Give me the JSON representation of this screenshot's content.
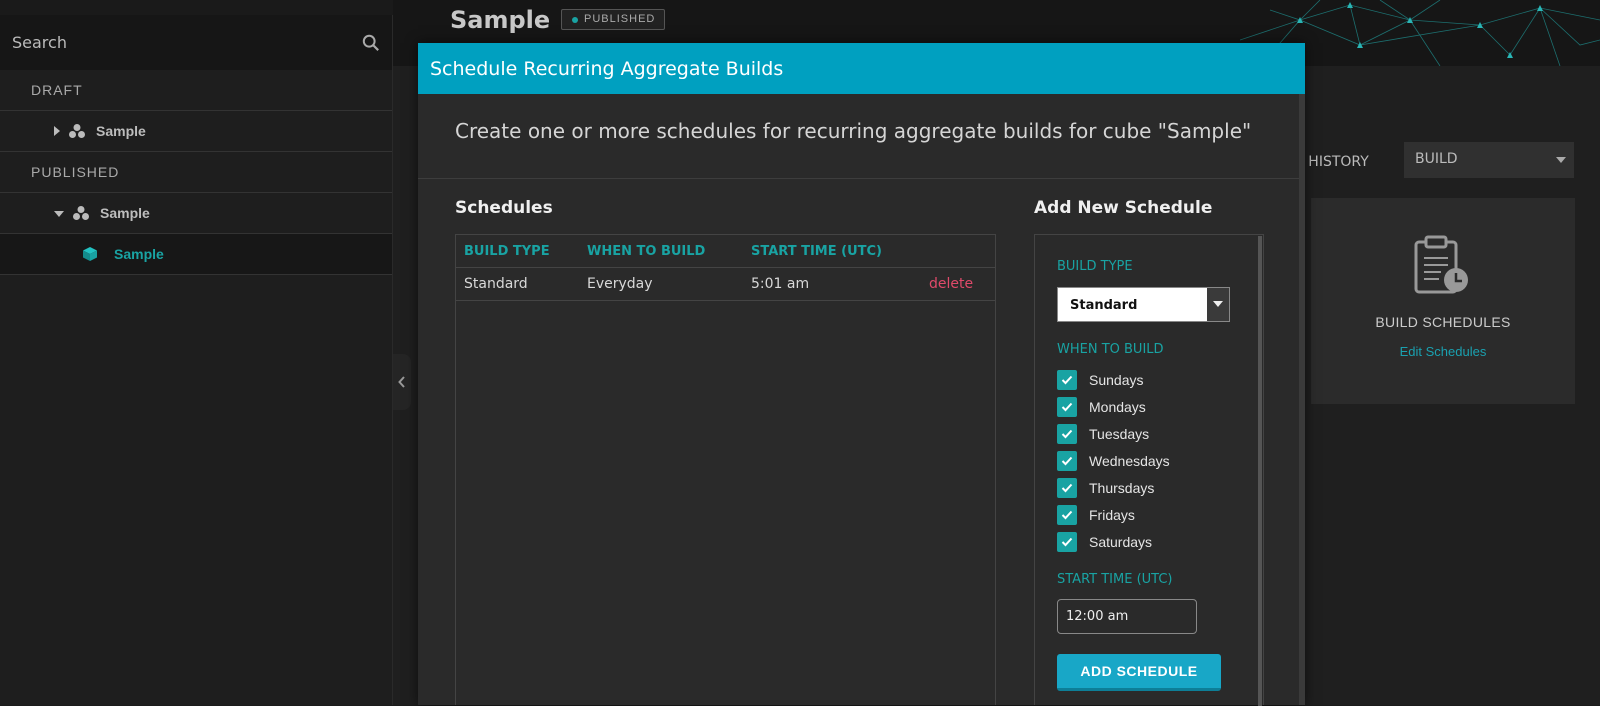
{
  "sidebar": {
    "search_placeholder": "Search",
    "sections": [
      {
        "label": "DRAFT",
        "items": [
          {
            "label": "Sample"
          }
        ]
      },
      {
        "label": "PUBLISHED",
        "items": [
          {
            "label": "Sample"
          }
        ],
        "child": {
          "label": "Sample"
        }
      }
    ]
  },
  "header": {
    "cube_title": "Sample",
    "status_badge": "PUBLISHED"
  },
  "background": {
    "history_label": "W HISTORY",
    "build_select_value": "BUILD",
    "card_title": "BUILD SCHEDULES",
    "card_link": "Edit Schedules"
  },
  "modal": {
    "title": "Schedule Recurring Aggregate Builds",
    "intro": "Create one or more schedules for recurring aggregate builds for cube \"Sample\"",
    "schedules_heading": "Schedules",
    "table": {
      "headers": [
        "BUILD TYPE",
        "WHEN TO BUILD",
        "START TIME (UTC)"
      ],
      "rows": [
        {
          "build_type": "Standard",
          "when": "Everyday",
          "start": "5:01 am",
          "action": "delete"
        }
      ]
    },
    "add": {
      "heading": "Add New Schedule",
      "build_type_label": "BUILD TYPE",
      "build_type_value": "Standard",
      "when_label": "WHEN TO BUILD",
      "days": [
        "Sundays",
        "Mondays",
        "Tuesdays",
        "Wednesdays",
        "Thursdays",
        "Fridays",
        "Saturdays"
      ],
      "start_label": "START TIME (UTC)",
      "start_value": "12:00 am",
      "button_label": "ADD SCHEDULE"
    }
  },
  "colors": {
    "accent_teal": "#19a3a3",
    "modal_header": "#00a0c0",
    "delete_red": "#e04a6a"
  }
}
